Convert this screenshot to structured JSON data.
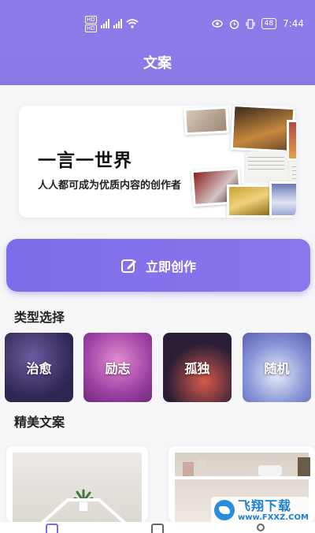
{
  "status_bar": {
    "hd1": "HD",
    "hd2": "HD",
    "time": "7:44",
    "battery": "48"
  },
  "header": {
    "title": "文案"
  },
  "banner": {
    "headline": "一言一世界",
    "subline": "人人都可成为优质内容的创作者"
  },
  "create_button": {
    "label": "立即创作"
  },
  "categories": {
    "title": "类型选择",
    "items": [
      {
        "label": "治愈"
      },
      {
        "label": "励志"
      },
      {
        "label": "孤独"
      },
      {
        "label": "随机"
      }
    ]
  },
  "featured": {
    "title": "精美文案"
  },
  "watermark": {
    "main": "飞翔下载",
    "url": "www.FXXZ.COM"
  },
  "colors": {
    "accent": "#8a78e6",
    "background": "#f6f6f8"
  },
  "bottom_nav": {
    "items": [
      {
        "icon": "home-icon",
        "active": true
      },
      {
        "icon": "list-icon",
        "active": false
      },
      {
        "icon": "profile-icon",
        "active": false
      }
    ]
  }
}
